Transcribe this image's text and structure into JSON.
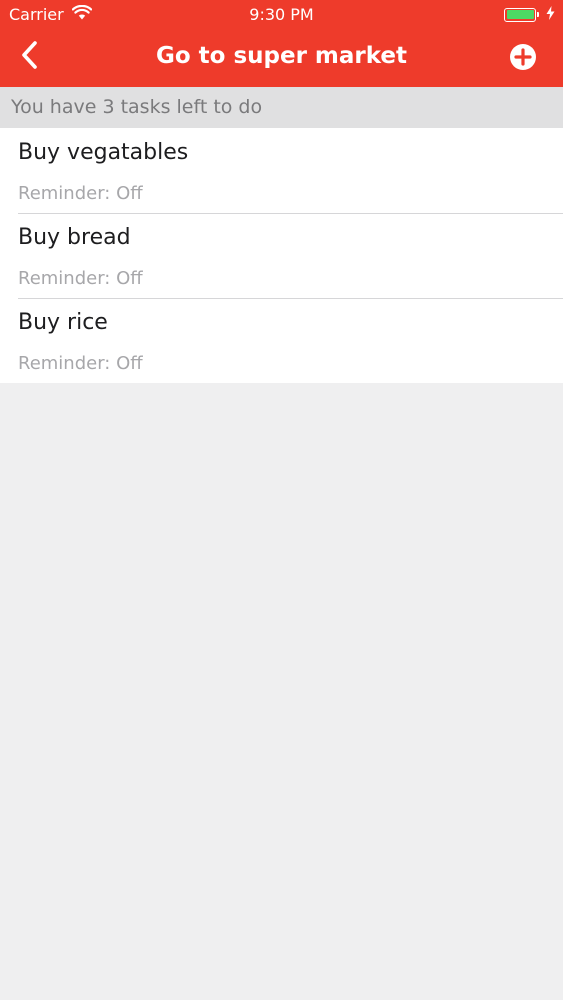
{
  "status_bar": {
    "carrier": "Carrier",
    "time": "9:30 PM",
    "wifi_icon": "wifi-icon",
    "battery_icon": "battery-icon",
    "charging_icon": "bolt-icon",
    "battery_level": 1.0
  },
  "nav": {
    "title": "Go to super market",
    "back_icon": "chevron-left-icon",
    "add_icon": "plus-circle-icon"
  },
  "summary": {
    "text": "You have 3 tasks left to do"
  },
  "tasks": [
    {
      "title": "Buy vegatables",
      "reminder": "Reminder: Off"
    },
    {
      "title": "Buy bread",
      "reminder": "Reminder: Off"
    },
    {
      "title": "Buy rice",
      "reminder": "Reminder: Off"
    }
  ],
  "colors": {
    "primary": "#ee3b2b",
    "background": "#efeff0",
    "summary_background": "#e0e0e1",
    "battery_fill": "#4cd964"
  }
}
